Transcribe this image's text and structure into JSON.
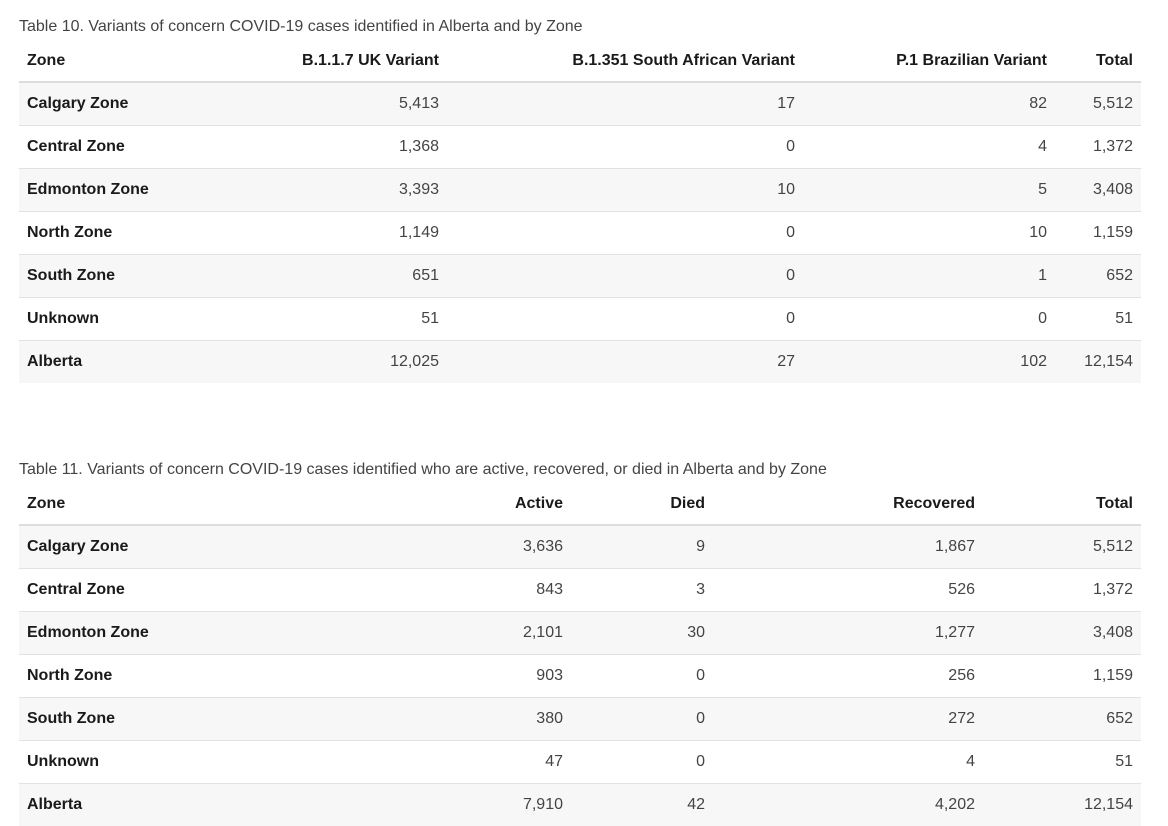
{
  "table10": {
    "caption": "Table 10. Variants of concern COVID-19 cases identified in Alberta and by Zone",
    "headers": [
      "Zone",
      "B.1.1.7 UK Variant",
      "B.1.351 South African Variant",
      "P.1 Brazilian Variant",
      "Total"
    ],
    "rows": [
      [
        "Calgary Zone",
        "5,413",
        "17",
        "82",
        "5,512"
      ],
      [
        "Central Zone",
        "1,368",
        "0",
        "4",
        "1,372"
      ],
      [
        "Edmonton Zone",
        "3,393",
        "10",
        "5",
        "3,408"
      ],
      [
        "North Zone",
        "1,149",
        "0",
        "10",
        "1,159"
      ],
      [
        "South Zone",
        "651",
        "0",
        "1",
        "652"
      ],
      [
        "Unknown",
        "51",
        "0",
        "0",
        "51"
      ],
      [
        "Alberta",
        "12,025",
        "27",
        "102",
        "12,154"
      ]
    ]
  },
  "table11": {
    "caption": "Table 11. Variants of concern COVID-19 cases identified who are active, recovered, or died in Alberta and by Zone",
    "headers": [
      "Zone",
      "Active",
      "Died",
      "Recovered",
      "Total"
    ],
    "rows": [
      [
        "Calgary Zone",
        "3,636",
        "9",
        "1,867",
        "5,512"
      ],
      [
        "Central Zone",
        "843",
        "3",
        "526",
        "1,372"
      ],
      [
        "Edmonton Zone",
        "2,101",
        "30",
        "1,277",
        "3,408"
      ],
      [
        "North Zone",
        "903",
        "0",
        "256",
        "1,159"
      ],
      [
        "South Zone",
        "380",
        "0",
        "272",
        "652"
      ],
      [
        "Unknown",
        "47",
        "0",
        "4",
        "51"
      ],
      [
        "Alberta",
        "7,910",
        "42",
        "4,202",
        "12,154"
      ]
    ]
  }
}
